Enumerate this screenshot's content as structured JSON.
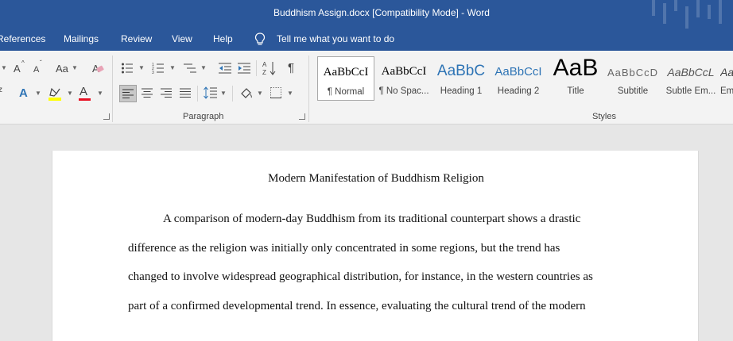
{
  "window": {
    "title": "Buddhism Assign.docx [Compatibility Mode]  -  Word"
  },
  "menu": {
    "references": "References",
    "mailings": "Mailings",
    "review": "Review",
    "view": "View",
    "help": "Help",
    "tell_me": "Tell me what you want to do"
  },
  "ribbon": {
    "paragraph_label": "Paragraph",
    "styles_label": "Styles",
    "styles": [
      {
        "preview": "AaBbCcI",
        "name": "¶ Normal"
      },
      {
        "preview": "AaBbCcI",
        "name": "¶ No Spac..."
      },
      {
        "preview": "AaBbC",
        "name": "Heading 1"
      },
      {
        "preview": "AaBbCcI",
        "name": "Heading 2"
      },
      {
        "preview": "AaB",
        "name": "Title"
      },
      {
        "preview": "AaBbCcD",
        "name": "Subtitle"
      },
      {
        "preview": "AaBbCcL",
        "name": "Subtle Em..."
      },
      {
        "preview": "AaB",
        "name": "Em"
      }
    ],
    "glyphs": {
      "grow_font": "A",
      "shrink_font": "A",
      "change_case": "Aa",
      "font_color": "A",
      "text_effects": "A",
      "superscript_fragment": "z"
    }
  },
  "document": {
    "title": "Modern Manifestation of Buddhism Religion",
    "lines": [
      "A comparison of modern-day Buddhism from its traditional counterpart shows a drastic",
      "difference as the religion was initially only concentrated in some regions, but the trend has",
      "changed to involve widespread geographical distribution, for instance, in the western countries as",
      "part of a confirmed developmental trend. In essence, evaluating the cultural trend of the modern"
    ]
  },
  "colors": {
    "title_bar": "#2b579a",
    "ribbon_bg": "#f3f3f3",
    "doc_bg": "#e6e6e6",
    "highlight": "#ffff00",
    "font_color_bar": "#e81123",
    "heading_blue": "#2e74b5"
  }
}
